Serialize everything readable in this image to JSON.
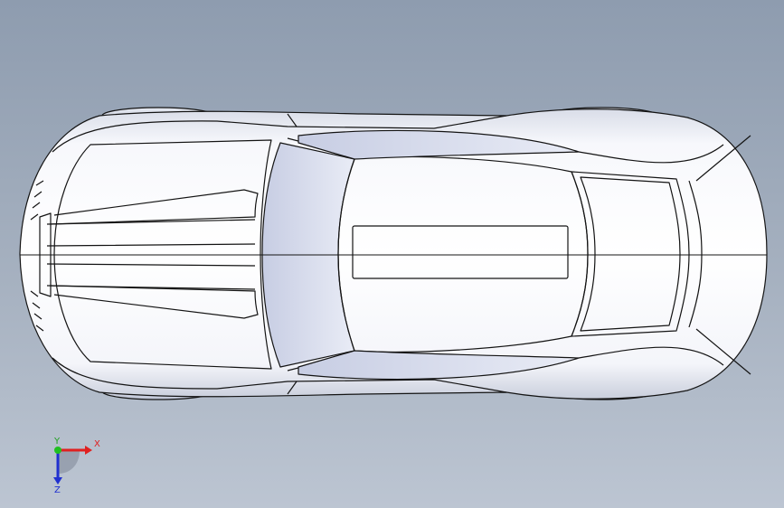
{
  "viewport": {
    "background_top": "#8e9caf",
    "background_bottom": "#bcc5d2",
    "model": "car-body-top-view",
    "edge_color": "#141414"
  },
  "triad": {
    "x_label": "X",
    "y_label": "Y",
    "z_label": "Z",
    "x_color": "#e02020",
    "y_color": "#20c020",
    "z_color": "#2030d0"
  }
}
